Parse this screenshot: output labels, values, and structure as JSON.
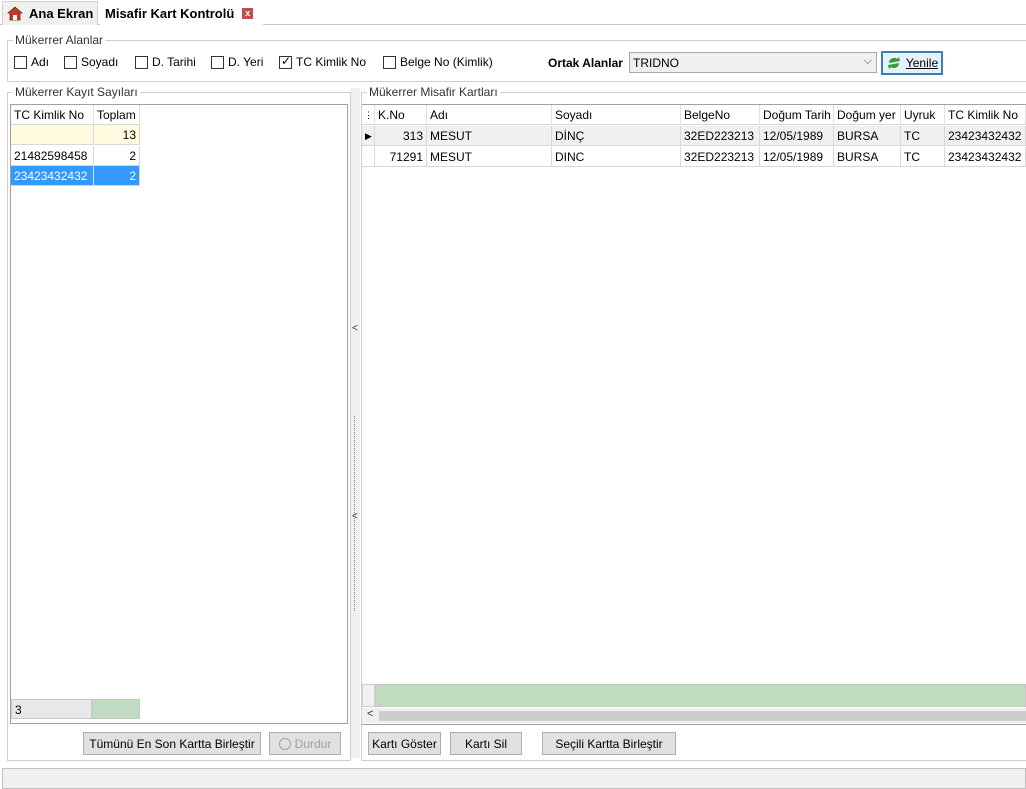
{
  "tabs": [
    {
      "label": "Ana Ekran"
    },
    {
      "label": "Misafir Kart Kontrolü",
      "close": "x"
    }
  ],
  "duplicate_fields": {
    "title": "Mükerrer Alanlar",
    "checkboxes": [
      {
        "label": "Adı",
        "checked": false
      },
      {
        "label": "Soyadı",
        "checked": false
      },
      {
        "label": "D. Tarihi",
        "checked": false
      },
      {
        "label": "D. Yeri",
        "checked": false
      },
      {
        "label": "TC Kimlik No",
        "checked": true
      },
      {
        "label": "Belge No (Kimlik)",
        "checked": false
      }
    ],
    "common_label": "Ortak Alanlar",
    "common_value": "TRIDNO",
    "refresh_label": "Yenile"
  },
  "counts": {
    "title": "Mükerrer Kayıt Sayıları",
    "headers": [
      "TC Kimlik No",
      "Toplam"
    ],
    "total": "13",
    "rows": [
      [
        "21482598458",
        "2"
      ],
      [
        "23423432432",
        "2"
      ]
    ],
    "footer_count": "3",
    "merge_all_label": "Tümünü En Son Kartta Birleştir",
    "stop_label": "Durdur"
  },
  "cards": {
    "title": "Mükerrer Misafir Kartları",
    "headers": [
      "K.No",
      "Adı",
      "Soyadı",
      "BelgeNo",
      "Doğum Tarih",
      "Doğum yer",
      "Uyruk",
      "TC Kimlik No"
    ],
    "rows": [
      [
        "313",
        "MESUT",
        "DİNÇ",
        "32ED223213",
        "12/05/1989",
        "BURSA",
        "TC",
        "23423432432"
      ],
      [
        "71291",
        "MESUT",
        "DINC",
        "32ED223213",
        "12/05/1989",
        "BURSA",
        "TC",
        "23423432432"
      ]
    ],
    "show_label": "Kartı Göster",
    "delete_label": "Kartı Sil",
    "merge_selected_label": "Seçili Kartta Birleştir"
  },
  "colors": {
    "accent": "#3399ff",
    "total_row": "#fffbe0",
    "footer_green": "#c0dcc0"
  }
}
